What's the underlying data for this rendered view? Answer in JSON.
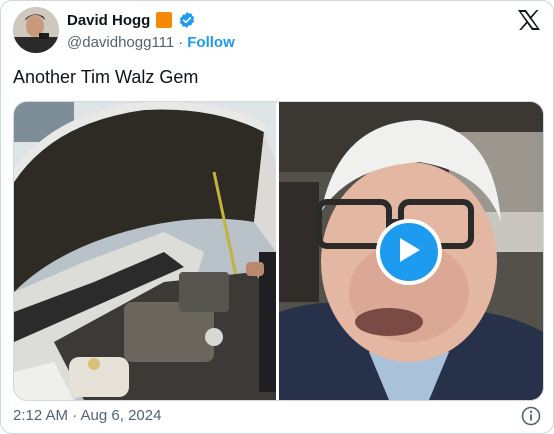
{
  "author": {
    "name": "David Hogg",
    "handle": "@davidhogg111",
    "separator": "·",
    "follow_label": "Follow",
    "badges": [
      "orange-square-icon",
      "verified-badge-icon"
    ]
  },
  "tweet": {
    "text": "Another Tim Walz Gem",
    "timestamp": "2:12 AM · Aug 6, 2024"
  },
  "media": {
    "left_image": "car-engine-photo",
    "right_video": "man-in-car-video-thumbnail",
    "play_icon": "play-icon"
  },
  "colors": {
    "accent": "#1d9bf0",
    "orange_badge": "#f58a07",
    "text_primary": "#0f1419",
    "text_secondary": "#536471"
  }
}
